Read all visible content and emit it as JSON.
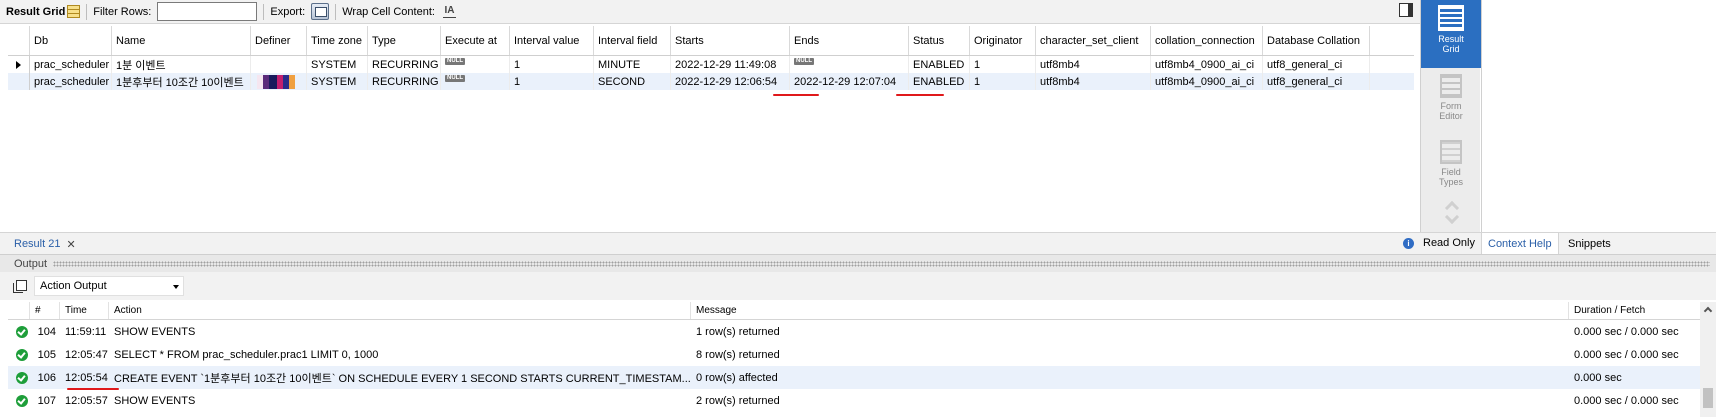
{
  "toolbar": {
    "result_grid_label": "Result Grid",
    "filter_rows_label": "Filter Rows:",
    "filter_rows_value": "",
    "export_label": "Export:",
    "wrap_cell_label": "Wrap Cell Content:"
  },
  "grid": {
    "columns": [
      "Db",
      "Name",
      "Definer",
      "Time zone",
      "Type",
      "Execute at",
      "Interval value",
      "Interval field",
      "Starts",
      "Ends",
      "Status",
      "Originator",
      "character_set_client",
      "collation_connection",
      "Database Collation"
    ],
    "rows": [
      {
        "db": "prac_scheduler",
        "name": "1분 이벤트",
        "timezone": "SYSTEM",
        "type": "RECURRING",
        "execute_at": "NULL",
        "interval_value": "1",
        "interval_field": "MINUTE",
        "starts": "2022-12-29 11:49:08",
        "ends": "NULL",
        "status": "ENABLED",
        "originator": "1",
        "charset": "utf8mb4",
        "collation": "utf8mb4_0900_ai_ci",
        "db_collation": "utf8_general_ci"
      },
      {
        "db": "prac_scheduler",
        "name": "1분후부터 10조간 10이벤트",
        "timezone": "SYSTEM",
        "type": "RECURRING",
        "execute_at": "NULL",
        "interval_value": "1",
        "interval_field": "SECOND",
        "starts": "2022-12-29 12:06:54",
        "ends": "2022-12-29 12:07:04",
        "status": "ENABLED",
        "originator": "1",
        "charset": "utf8mb4",
        "collation": "utf8mb4_0900_ai_ci",
        "db_collation": "utf8_general_ci"
      }
    ]
  },
  "sidebar": {
    "result_grid": "Result Grid",
    "form_editor": "Form Editor",
    "field_types": "Field Types"
  },
  "result_tabs": {
    "tab_label": "Result 21",
    "read_only": "Read Only",
    "context_help": "Context Help",
    "snippets": "Snippets"
  },
  "output": {
    "title": "Output",
    "selector": "Action Output",
    "columns": [
      "#",
      "Time",
      "Action",
      "Message",
      "Duration / Fetch"
    ],
    "rows": [
      {
        "num": "104",
        "time": "11:59:11",
        "action": "SHOW EVENTS",
        "message": "1 row(s) returned",
        "duration": "0.000 sec / 0.000 sec"
      },
      {
        "num": "105",
        "time": "12:05:47",
        "action": "SELECT * FROM prac_scheduler.prac1 LIMIT 0, 1000",
        "message": "8 row(s) returned",
        "duration": "0.000 sec / 0.000 sec"
      },
      {
        "num": "106",
        "time": "12:05:54",
        "action": "CREATE EVENT `1분후부터 10조간 10이벤트` ON SCHEDULE EVERY 1 SECOND STARTS CURRENT_TIMESTAM...",
        "message": "0 row(s) affected",
        "duration": "0.000 sec"
      },
      {
        "num": "107",
        "time": "12:05:57",
        "action": "SHOW EVENTS",
        "message": "2 row(s) returned",
        "duration": "0.000 sec / 0.000 sec"
      }
    ]
  },
  "colors": {
    "accent": "#2b6fc1",
    "annotation_red": "#e0191b",
    "success_green": "#1e9e3a",
    "row_alt": "#eaf1fb"
  }
}
